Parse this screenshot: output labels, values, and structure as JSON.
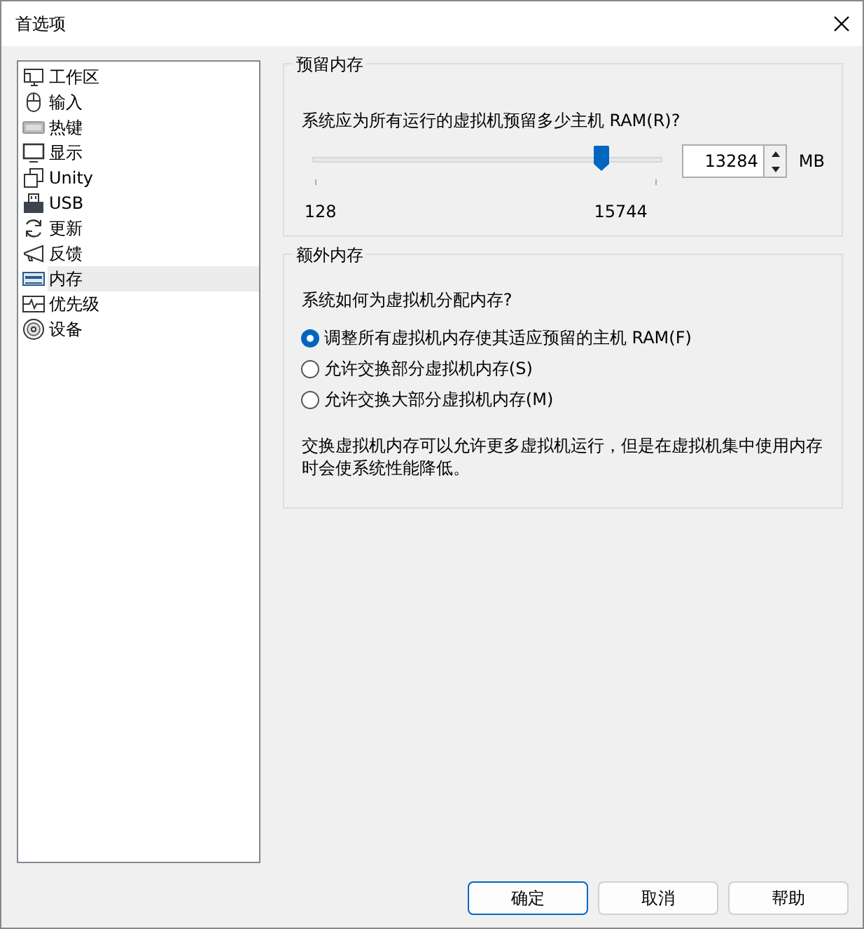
{
  "window": {
    "title": "首选项"
  },
  "sidebar": {
    "items": [
      {
        "label": "工作区",
        "kind": "workspace",
        "selected": false
      },
      {
        "label": "输入",
        "kind": "mouse",
        "selected": false
      },
      {
        "label": "热键",
        "kind": "keyboard",
        "selected": false
      },
      {
        "label": "显示",
        "kind": "monitor",
        "selected": false
      },
      {
        "label": "Unity",
        "kind": "windows",
        "selected": false
      },
      {
        "label": "USB",
        "kind": "usb",
        "selected": false
      },
      {
        "label": "更新",
        "kind": "refresh",
        "selected": false
      },
      {
        "label": "反馈",
        "kind": "megaphone",
        "selected": false
      },
      {
        "label": "内存",
        "kind": "memory",
        "selected": true
      },
      {
        "label": "优先级",
        "kind": "pulse",
        "selected": false
      },
      {
        "label": "设备",
        "kind": "disc",
        "selected": false
      }
    ]
  },
  "reserved_memory": {
    "title": "预留内存",
    "question": "系统应为所有运行的虚拟机预留多少主机 RAM(R)?",
    "slider": {
      "level": 0.83,
      "min_label": "128",
      "max_label": "15744"
    },
    "value": "13284",
    "unit": "MB"
  },
  "additional_memory": {
    "title": "额外内存",
    "question": "系统如何为虚拟机分配内存?",
    "options": [
      {
        "label": "调整所有虚拟机内存使其适应预留的主机 RAM(F)",
        "selected": true
      },
      {
        "label": "允许交换部分虚拟机内存(S)",
        "selected": false
      },
      {
        "label": "允许交换大部分虚拟机内存(M)",
        "selected": false
      }
    ],
    "note": "交换虚拟机内存可以允许更多虚拟机运行，但是在虚拟机集中使用内存时会使系统性能降低。"
  },
  "buttons": [
    {
      "label": "确定",
      "default": true
    },
    {
      "label": "取消",
      "default": false
    },
    {
      "label": "帮助",
      "default": false
    }
  ]
}
